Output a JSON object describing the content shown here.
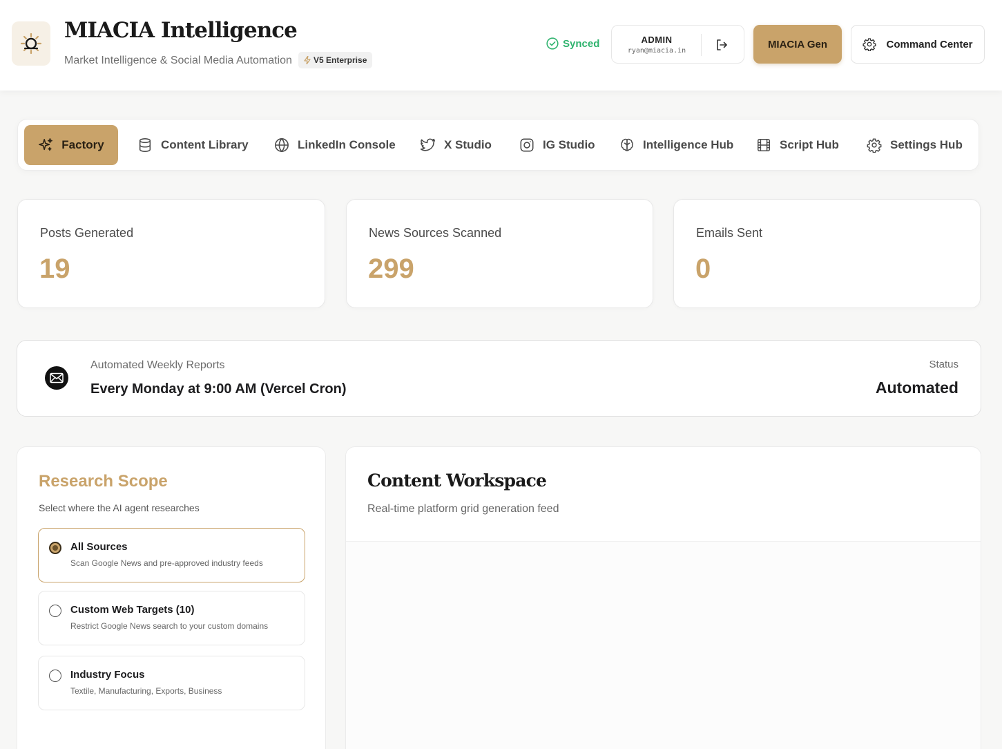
{
  "header": {
    "title": "MIACIA Intelligence",
    "subtitle": "Market Intelligence & Social Media Automation",
    "version_badge": "V5 Enterprise",
    "sync_status": "Synced",
    "user": {
      "role": "ADMIN",
      "email": "ryan@miacia.in"
    },
    "gen_button": "MIACIA Gen",
    "command_button": "Command Center"
  },
  "tabs": [
    {
      "label": "Factory",
      "icon": "sparkles-icon",
      "active": true
    },
    {
      "label": "Content Library",
      "icon": "database-icon"
    },
    {
      "label": "LinkedIn Console",
      "icon": "globe-icon"
    },
    {
      "label": "X Studio",
      "icon": "twitter-icon"
    },
    {
      "label": "IG Studio",
      "icon": "instagram-icon"
    },
    {
      "label": "Intelligence Hub",
      "icon": "brain-icon"
    },
    {
      "label": "Script Hub",
      "icon": "film-icon"
    },
    {
      "label": "Settings Hub",
      "icon": "gear-icon"
    }
  ],
  "stats": [
    {
      "label": "Posts Generated",
      "value": "19"
    },
    {
      "label": "News Sources Scanned",
      "value": "299"
    },
    {
      "label": "Emails Sent",
      "value": "0"
    }
  ],
  "reports": {
    "label": "Automated Weekly Reports",
    "schedule": "Every Monday at 9:00 AM (Vercel Cron)",
    "status_label": "Status",
    "status_value": "Automated"
  },
  "research_scope": {
    "title": "Research Scope",
    "subtitle": "Select where the AI agent researches",
    "options": [
      {
        "title": "All Sources",
        "description": "Scan Google News and pre-approved industry feeds",
        "selected": true
      },
      {
        "title": "Custom Web Targets (10)",
        "description": "Restrict Google News search to your custom domains",
        "selected": false
      },
      {
        "title": "Industry Focus",
        "description": "Textile, Manufacturing, Exports, Business",
        "selected": false
      }
    ]
  },
  "workspace": {
    "title": "Content Workspace",
    "subtitle": "Real-time platform grid generation feed"
  },
  "colors": {
    "accent": "#c9a36a",
    "success": "#2fb36e",
    "background": "#f7f7f6"
  }
}
